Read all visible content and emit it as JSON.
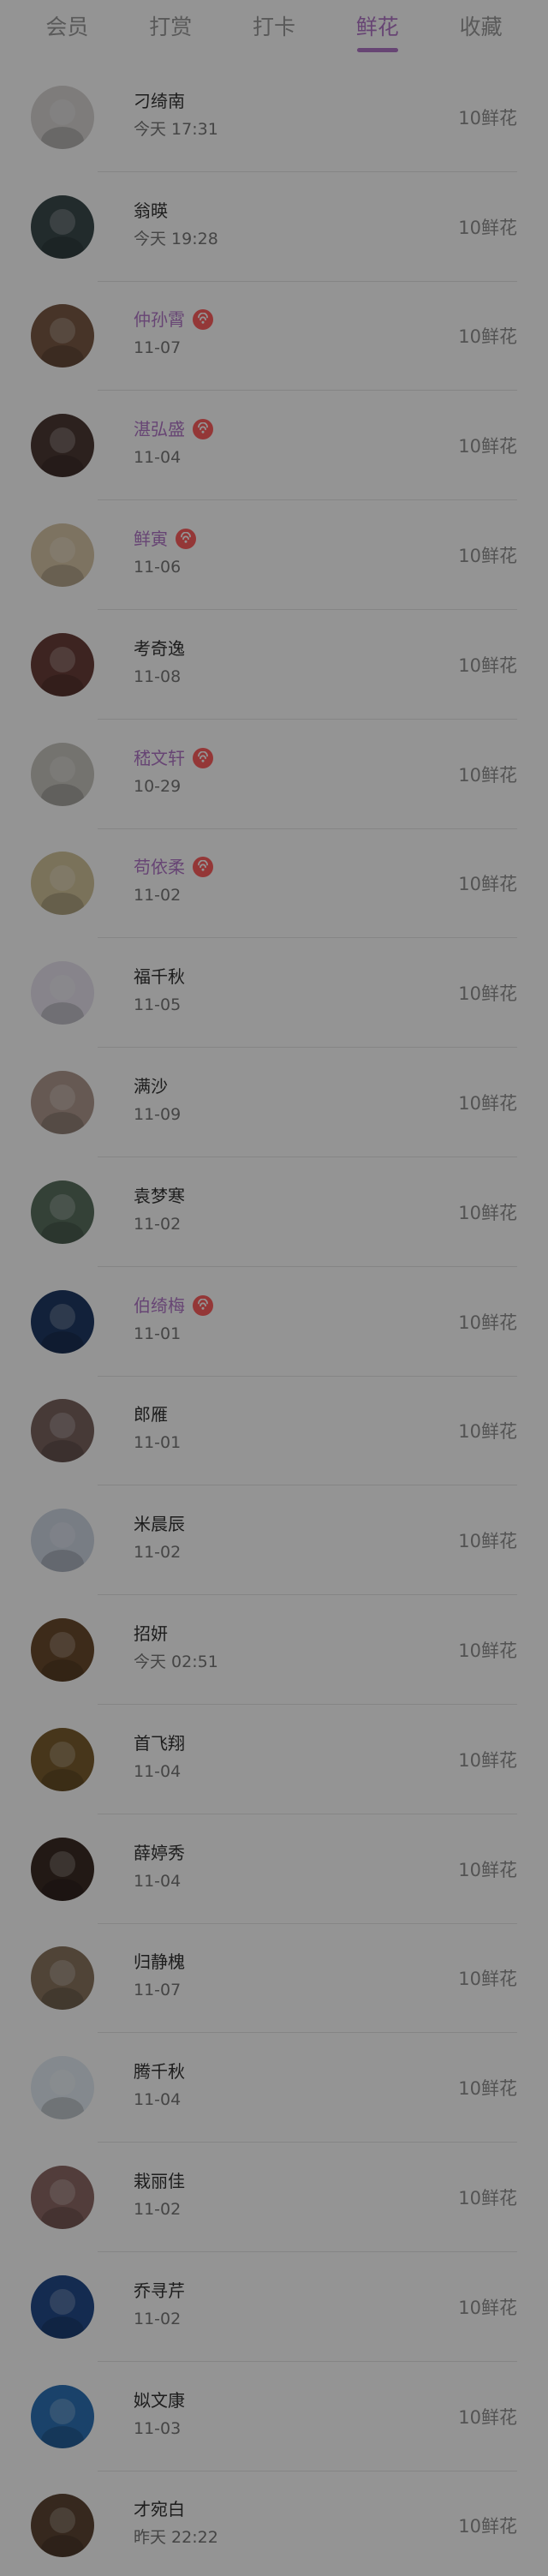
{
  "tabs": [
    {
      "label": "会员",
      "active": false
    },
    {
      "label": "打赏",
      "active": false
    },
    {
      "label": "打卡",
      "active": false
    },
    {
      "label": "鲜花",
      "active": true
    },
    {
      "label": "收藏",
      "active": false
    }
  ],
  "entries": [
    {
      "name": "刁绮南",
      "time": "今天 17:31",
      "amount": "10鲜花",
      "vip": false,
      "avatar_color": "#d9d6d5"
    },
    {
      "name": "翁暎",
      "time": "今天 19:28",
      "amount": "10鲜花",
      "vip": false,
      "avatar_color": "#3b4a4d"
    },
    {
      "name": "仲孙霄",
      "time": "11-07",
      "amount": "10鲜花",
      "vip": true,
      "avatar_color": "#7a5a45"
    },
    {
      "name": "湛弘盛",
      "time": "11-04",
      "amount": "10鲜花",
      "vip": true,
      "avatar_color": "#4d3a35"
    },
    {
      "name": "鲜寅",
      "time": "11-06",
      "amount": "10鲜花",
      "vip": true,
      "avatar_color": "#d8c6a7"
    },
    {
      "name": "考奇逸",
      "time": "11-08",
      "amount": "10鲜花",
      "vip": false,
      "avatar_color": "#6a3f3a"
    },
    {
      "name": "嵇文轩",
      "time": "10-29",
      "amount": "10鲜花",
      "vip": true,
      "avatar_color": "#c9c6c0"
    },
    {
      "name": "苟依柔",
      "time": "11-02",
      "amount": "10鲜花",
      "vip": true,
      "avatar_color": "#d2c49b"
    },
    {
      "name": "福千秋",
      "time": "11-05",
      "amount": "10鲜花",
      "vip": false,
      "avatar_color": "#e8e4ef"
    },
    {
      "name": "满沙",
      "time": "11-09",
      "amount": "10鲜花",
      "vip": false,
      "avatar_color": "#b09a8f"
    },
    {
      "name": "袁梦寒",
      "time": "11-02",
      "amount": "10鲜花",
      "vip": false,
      "avatar_color": "#5a7160"
    },
    {
      "name": "伯绮梅",
      "time": "11-01",
      "amount": "10鲜花",
      "vip": true,
      "avatar_color": "#1f3a65"
    },
    {
      "name": "郎雁",
      "time": "11-01",
      "amount": "10鲜花",
      "vip": false,
      "avatar_color": "#7a6460"
    },
    {
      "name": "米晨辰",
      "time": "11-02",
      "amount": "10鲜花",
      "vip": false,
      "avatar_color": "#cfd7e4"
    },
    {
      "name": "招妍",
      "time": "今天 02:51",
      "amount": "10鲜花",
      "vip": false,
      "avatar_color": "#6a4a2d"
    },
    {
      "name": "首飞翔",
      "time": "11-04",
      "amount": "10鲜花",
      "vip": false,
      "avatar_color": "#7a5d2f"
    },
    {
      "name": "薛婷秀",
      "time": "11-04",
      "amount": "10鲜花",
      "vip": false,
      "avatar_color": "#3b2c25"
    },
    {
      "name": "归静槐",
      "time": "11-07",
      "amount": "10鲜花",
      "vip": false,
      "avatar_color": "#8a7560"
    },
    {
      "name": "腾千秋",
      "time": "11-04",
      "amount": "10鲜花",
      "vip": false,
      "avatar_color": "#e4edf4"
    },
    {
      "name": "栽丽佳",
      "time": "11-02",
      "amount": "10鲜花",
      "vip": false,
      "avatar_color": "#8e6a66"
    },
    {
      "name": "乔寻芹",
      "time": "11-02",
      "amount": "10鲜花",
      "vip": false,
      "avatar_color": "#234b8b"
    },
    {
      "name": "姒文康",
      "time": "11-03",
      "amount": "10鲜花",
      "vip": false,
      "avatar_color": "#2d73b7"
    },
    {
      "name": "才宛白",
      "time": "昨天 22:22",
      "amount": "10鲜花",
      "vip": false,
      "avatar_color": "#5d4634"
    }
  ],
  "colors": {
    "accent": "#b277c8",
    "overlay": "rgba(0,0,0,0.42)",
    "badge": "#ff5f5f"
  }
}
